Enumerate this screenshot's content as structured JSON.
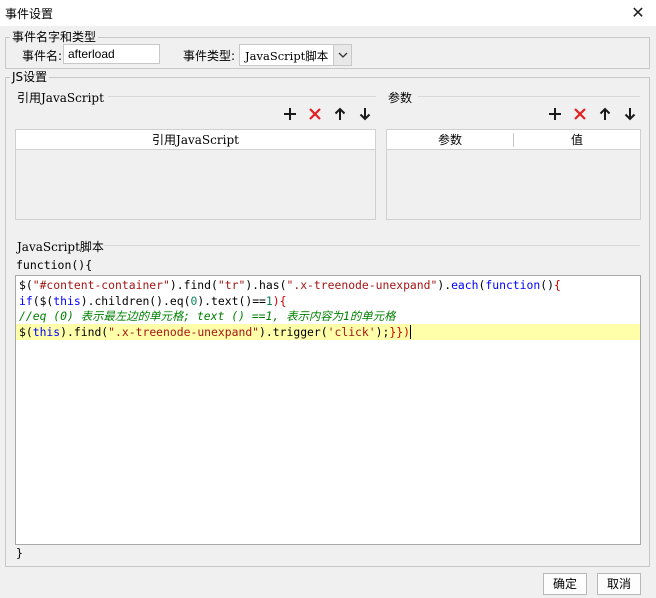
{
  "window": {
    "title": "事件设置",
    "close_glyph": "✕"
  },
  "event_group": {
    "legend": "事件名字和类型",
    "name_label": "事件名:",
    "name_value": "afterload",
    "type_label": "事件类型:",
    "type_value": "JavaScript脚本",
    "type_options_visible": [
      "JavaScript脚本"
    ]
  },
  "js_group": {
    "legend": "JS设置",
    "ref_js": {
      "title": "引用JavaScript",
      "columns": [
        "引用JavaScript"
      ],
      "rows": []
    },
    "params": {
      "title": "参数",
      "columns": [
        "参数",
        "值"
      ],
      "rows": []
    },
    "toolbar_icons": [
      "add-icon",
      "delete-icon",
      "move-up-icon",
      "move-down-icon"
    ],
    "icon_colors": {
      "add": "#1a1a1a",
      "delete": "#e02020",
      "arrow": "#1a1a1a"
    },
    "script": {
      "title": "JavaScript脚本",
      "header": "function(){",
      "footer": "}",
      "highlight_color": "#ffffaa",
      "lines": [
        {
          "highlight": false,
          "tokens": [
            {
              "t": "$(",
              "c": "plain"
            },
            {
              "t": "\"#content-container\"",
              "c": "str"
            },
            {
              "t": ").find(",
              "c": "plain"
            },
            {
              "t": "\"tr\"",
              "c": "str"
            },
            {
              "t": ").has(",
              "c": "plain"
            },
            {
              "t": "\".x-treenode-unexpand\"",
              "c": "str"
            },
            {
              "t": ").",
              "c": "plain"
            },
            {
              "t": "each",
              "c": "fn"
            },
            {
              "t": "(",
              "c": "plain"
            },
            {
              "t": "function",
              "c": "kw"
            },
            {
              "t": "()",
              "c": "plain"
            },
            {
              "t": "{",
              "c": "br"
            }
          ]
        },
        {
          "highlight": false,
          "tokens": [
            {
              "t": "if",
              "c": "kw"
            },
            {
              "t": "($(",
              "c": "plain"
            },
            {
              "t": "this",
              "c": "kw"
            },
            {
              "t": ").children().eq(",
              "c": "plain"
            },
            {
              "t": "0",
              "c": "num"
            },
            {
              "t": ").text()==",
              "c": "plain"
            },
            {
              "t": "1",
              "c": "num"
            },
            {
              "t": "){",
              "c": "br"
            }
          ]
        },
        {
          "highlight": false,
          "tokens": [
            {
              "t": "//eq (0) 表示最左边的单元格; text () ==1, 表示内容为1的单元格",
              "c": "cmt"
            }
          ]
        },
        {
          "highlight": true,
          "tokens": [
            {
              "t": "$(",
              "c": "plain"
            },
            {
              "t": "this",
              "c": "kw"
            },
            {
              "t": ").find(",
              "c": "plain"
            },
            {
              "t": "\".x-treenode-unexpand\"",
              "c": "str"
            },
            {
              "t": ").trigger(",
              "c": "plain"
            },
            {
              "t": "'click'",
              "c": "str"
            },
            {
              "t": ");",
              "c": "plain"
            },
            {
              "t": "}})",
              "c": "br"
            }
          ]
        }
      ]
    }
  },
  "buttons": {
    "ok": "确定",
    "cancel": "取消"
  }
}
